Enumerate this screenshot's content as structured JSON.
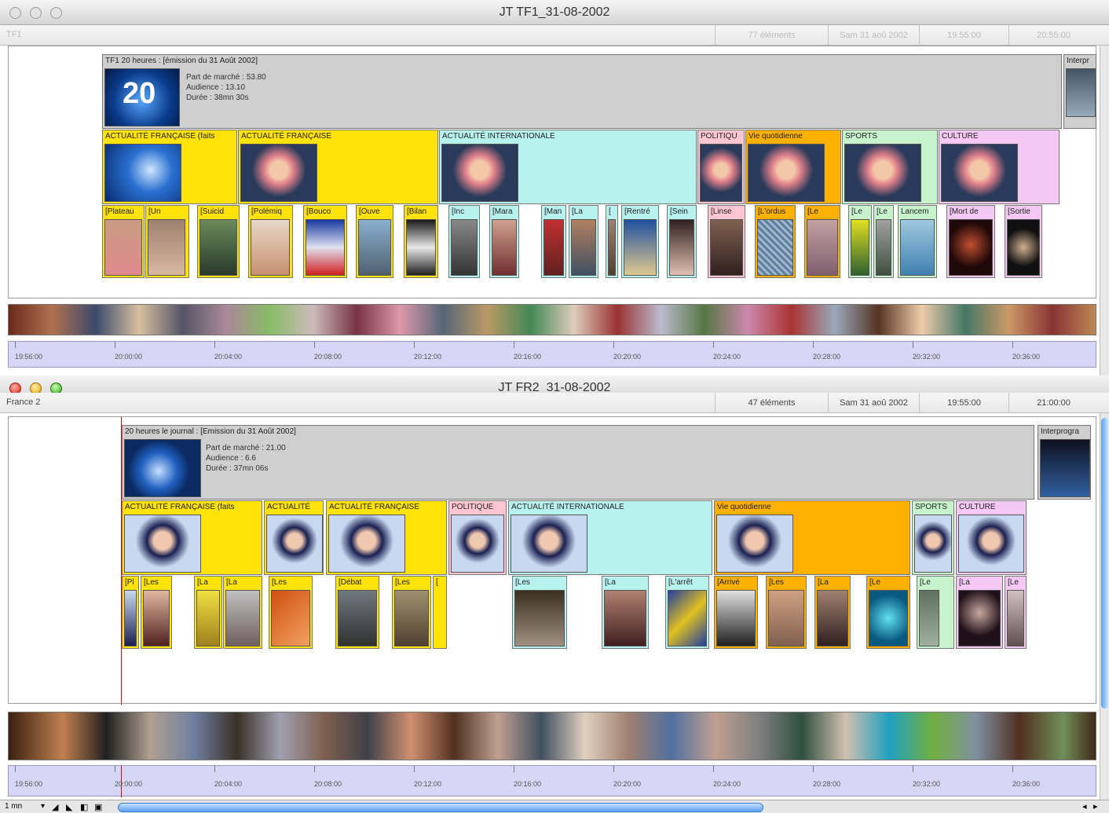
{
  "window1": {
    "title": "JT TF1_31-08-2002",
    "channel": "TF1",
    "info": {
      "elements": "77 éléments",
      "date": "Sam 31 aoû 2002",
      "start": "19:55:00",
      "end": "20:55:00"
    },
    "program": {
      "title": "TF1 20 heures : [émission du 31 Août 2002]",
      "share": "Part de marché : 53.80",
      "audience": "Audience : 13.10",
      "duration": "Durée : 38mn 30s",
      "logo_text": "20",
      "next": "Interpr"
    },
    "sections": [
      {
        "label": "ACTUALITÉ FRANÇAISE (faits"
      },
      {
        "label": "ACTUALITÉ FRANÇAISE"
      },
      {
        "label": "ACTUALITÉ INTERNATIONALE"
      },
      {
        "label": "POLITIQU"
      },
      {
        "label": "Vie quotidienne"
      },
      {
        "label": "SPORTS"
      },
      {
        "label": "CULTURE"
      }
    ],
    "stories": [
      "[Plateau",
      "[Un",
      "[Suicid",
      "[Polémiq",
      "[Bouco",
      "[Ouve",
      "[Bilan",
      "[Inc",
      "[Mara",
      "[Man",
      "[La",
      "[",
      "[Rentré",
      "[Sein",
      "[Linse",
      "[L'ordus",
      "[Le",
      "[Le",
      "[Le",
      "Lancem",
      "[Mort de",
      "[Sortie"
    ],
    "ruler": [
      "19:56:00",
      "20:00:00",
      "20:04:00",
      "20:08:00",
      "20:12:00",
      "20:16:00",
      "20:20:00",
      "20:24:00",
      "20:28:00",
      "20:32:00",
      "20:36:00"
    ]
  },
  "window2": {
    "title": "JT FR2_31-08-2002",
    "channel": "France 2",
    "info": {
      "elements": "47 éléments",
      "date": "Sam 31 aoû 2002",
      "start": "19:55:00",
      "end": "21:00:00"
    },
    "program": {
      "title": "20 heures le journal : [Emission du 31 Août 2002]",
      "share": "Part de marché : 21.00",
      "audience": "Audience : 6.6",
      "duration": "Durée : 37mn 06s",
      "next": "Interprogra"
    },
    "sections": [
      {
        "label": "ACTUALITÉ FRANÇAISE (faits"
      },
      {
        "label": "ACTUALITÉ"
      },
      {
        "label": "ACTUALITÉ FRANÇAISE"
      },
      {
        "label": "POLITIQUE"
      },
      {
        "label": "ACTUALITÉ INTERNATIONALE"
      },
      {
        "label": "Vie quotidienne"
      },
      {
        "label": "SPORTS"
      },
      {
        "label": "CULTURE"
      }
    ],
    "stories": [
      "[Pl",
      "[Les",
      "[La",
      "[La",
      "[Les",
      "[Débat",
      "[Les",
      "[",
      "[Les",
      "[La",
      "[L'arrêt",
      "[Arrivé",
      "[Les",
      "[La",
      "[Le",
      "[Le",
      "[La",
      "[Le"
    ],
    "ruler": [
      "19:56:00",
      "20:00:00",
      "20:04:00",
      "20:08:00",
      "20:12:00",
      "20:16:00",
      "20:20:00",
      "20:24:00",
      "20:28:00",
      "20:32:00",
      "20:36:00"
    ],
    "zoom": "1 mn"
  },
  "colors": {
    "yellow": "#ffe20a",
    "cyan": "#b8f2ef",
    "pink": "#ffc6d2",
    "orange": "#ffb000",
    "green": "#c6f3cb",
    "lilac": "#f3c8f2",
    "gray": "#cfcfcf",
    "ruler": "#d6d6f6"
  }
}
